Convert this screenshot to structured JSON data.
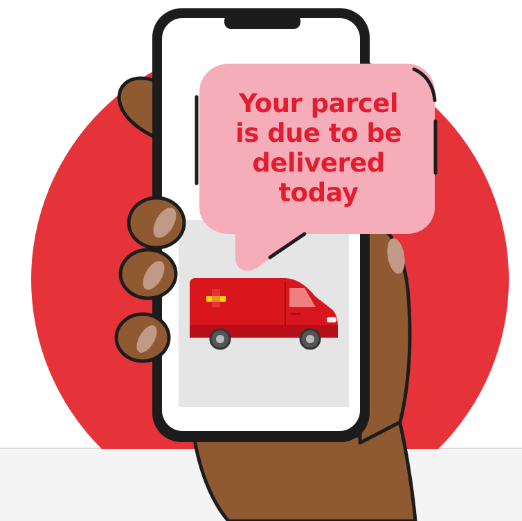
{
  "message": {
    "lines": [
      "Your parcel",
      "is due to be",
      "delivered",
      "today"
    ]
  },
  "icons": [
    "hand-illustration",
    "smartphone-icon",
    "speech-bubble",
    "delivery-van-icon"
  ],
  "colors": {
    "circle": "#E6333A",
    "bubble": "#F6ADBA",
    "text": "#E11E30",
    "skin": "#8F5A32",
    "nail": "#C09A86",
    "outline": "#1C1C1C",
    "screen": "#FFFFFF",
    "photo_bg": "#E5E5E5",
    "van": "#D9151E",
    "van_dark": "#B80E17",
    "van_logo": "#F6D10B",
    "floor": "#F4F4F4"
  }
}
